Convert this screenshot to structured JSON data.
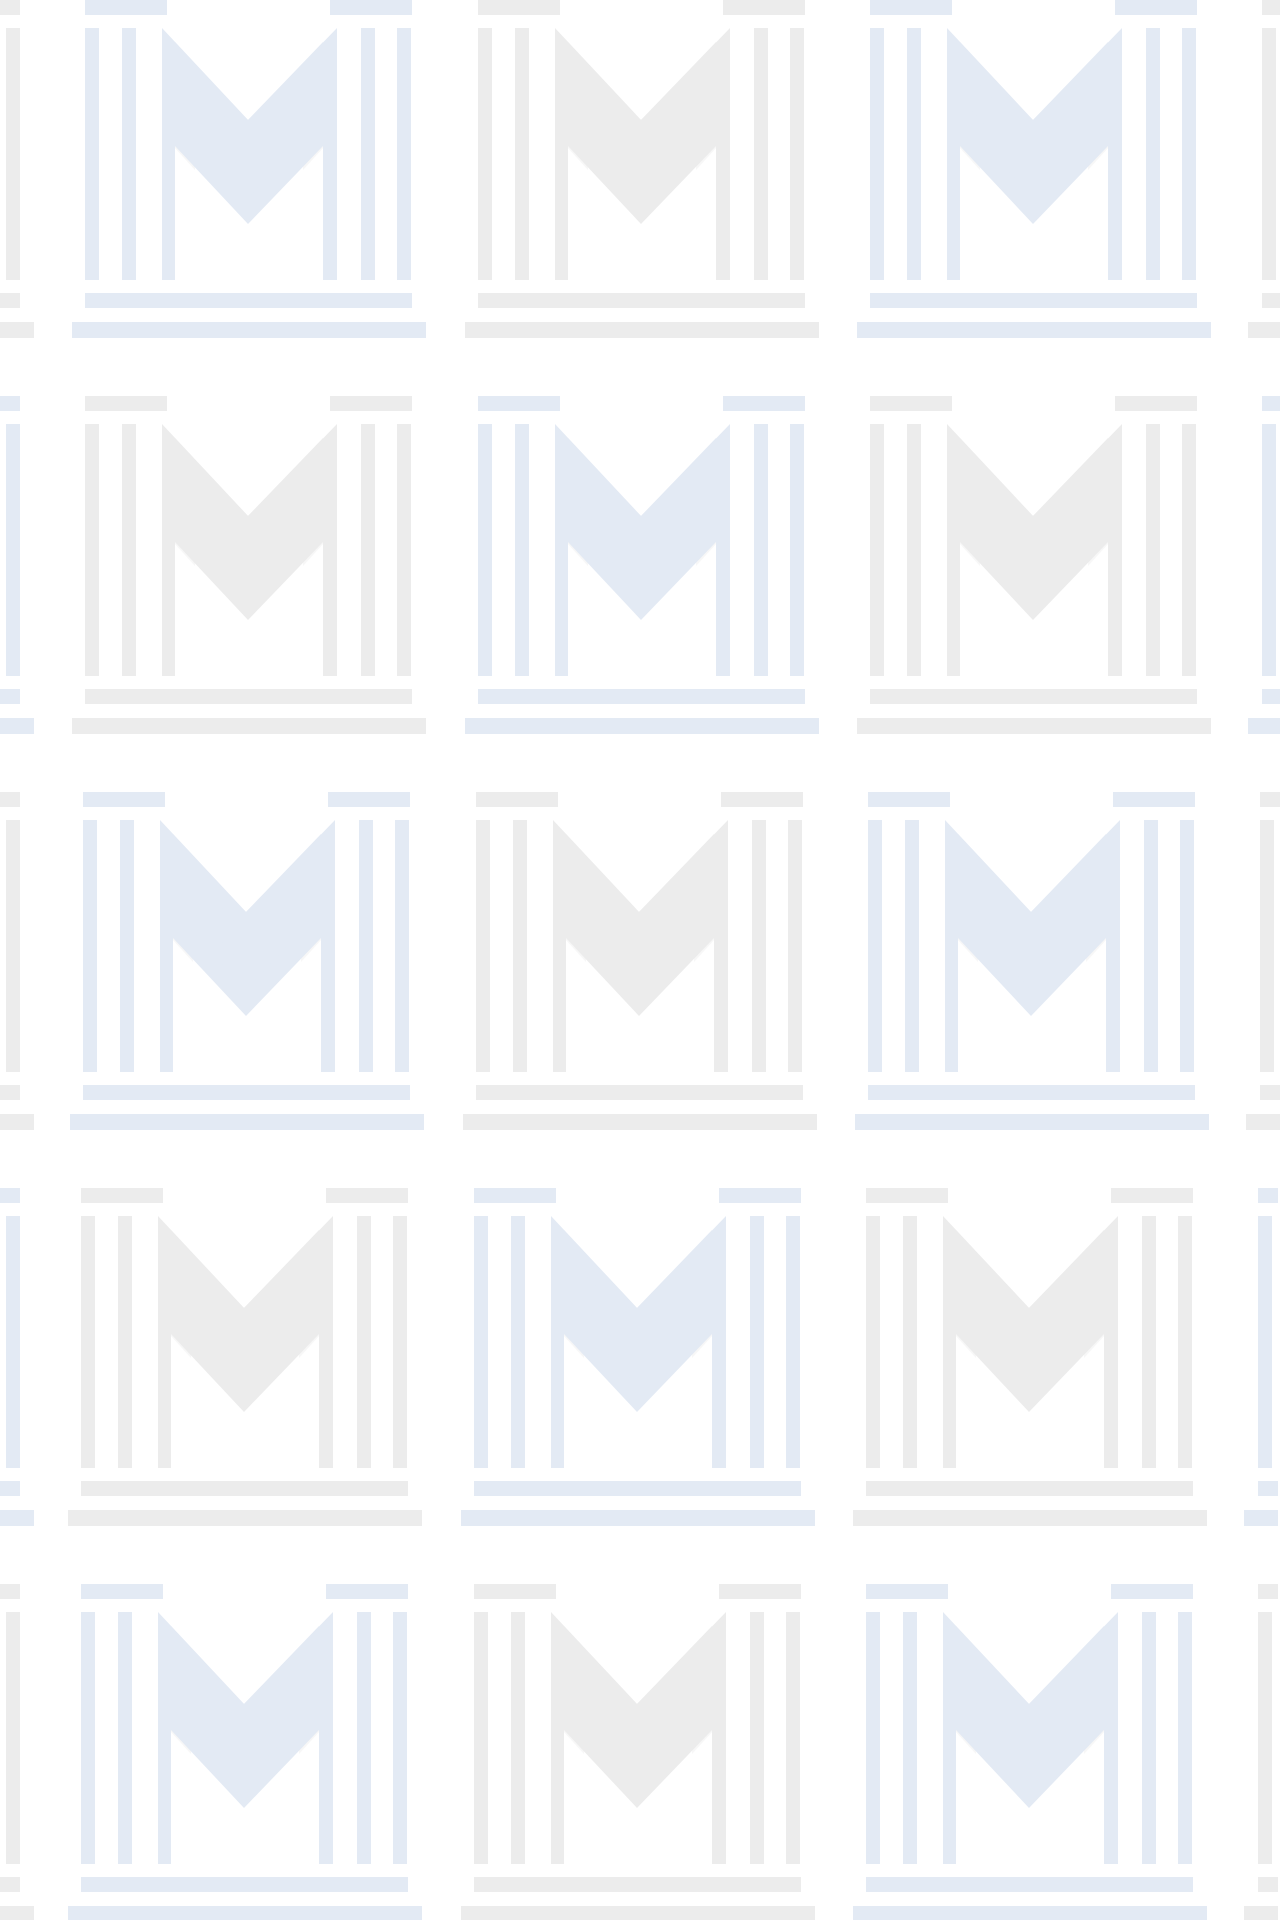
{
  "page": {
    "background": "#ffffff"
  },
  "pattern": {
    "motif_icon": "m-monogram-tile-icon",
    "colors": {
      "blue": "#e3eaf4",
      "gray": "#ececec",
      "shade": "#f7f7f7"
    },
    "column_count_full": 3,
    "row_count": 5,
    "rows": [
      [
        "blue",
        "gray",
        "blue"
      ],
      [
        "gray",
        "blue",
        "gray"
      ],
      [
        "blue",
        "gray",
        "blue"
      ],
      [
        "gray",
        "blue",
        "gray"
      ],
      [
        "blue",
        "gray",
        "blue"
      ]
    ],
    "left_edge_colors": [
      "gray",
      "blue",
      "gray",
      "blue",
      "gray"
    ],
    "right_edge_colors": [
      "gray",
      "blue",
      "gray",
      "blue",
      "gray"
    ]
  }
}
